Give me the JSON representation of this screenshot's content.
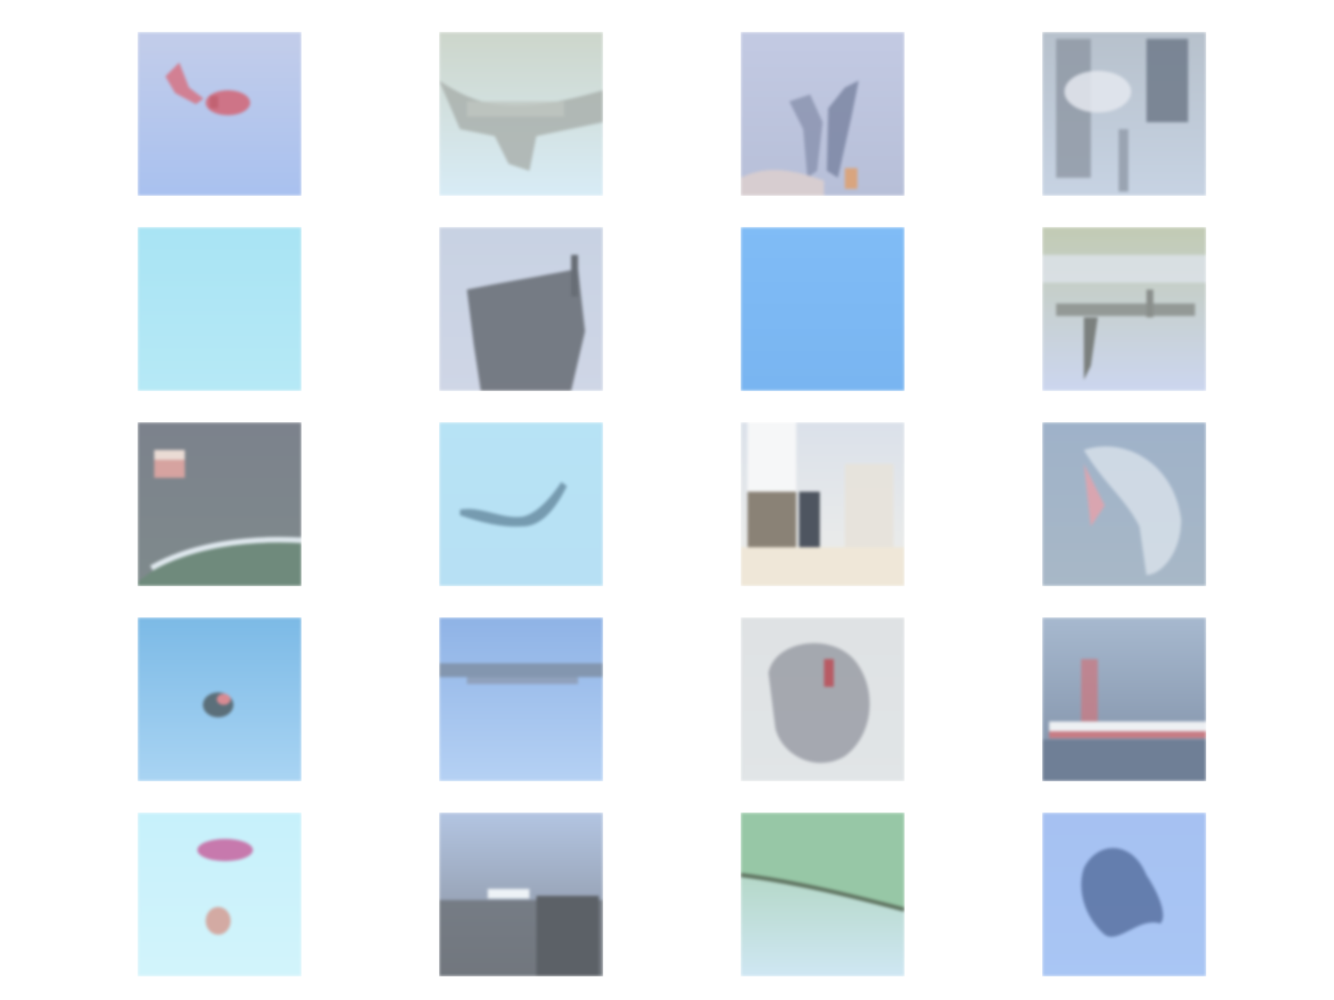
{
  "grid": {
    "rows": 5,
    "cols": 4,
    "tiles": [
      {
        "name": "tile-red-aircraft-sky",
        "bg_top": "#c3cdea",
        "bg_bottom": "#a9c1ef",
        "subject": "#d4788a"
      },
      {
        "name": "tile-gray-object-pale-sky",
        "bg_top": "#cdd6cb",
        "bg_bottom": "#d8ecf6",
        "subject": "#a7aeaa"
      },
      {
        "name": "tile-figures-gray-sky",
        "bg_top": "#c3cae3",
        "bg_bottom": "#b7bfd8",
        "subject": "#8e97b2"
      },
      {
        "name": "tile-dark-structure",
        "bg_top": "#b7c1cc",
        "bg_bottom": "#c7d3e3",
        "subject": "#737e8e"
      },
      {
        "name": "tile-plain-cyan-sky",
        "bg_top": "#a9e4f4",
        "bg_bottom": "#b6e9f6",
        "subject": "#a9e4f4"
      },
      {
        "name": "tile-dark-ship-hull",
        "bg_top": "#c8d2e3",
        "bg_bottom": "#cfd6e6",
        "subject": "#6c7179"
      },
      {
        "name": "tile-plain-blue-sky",
        "bg_top": "#80bcf6",
        "bg_bottom": "#79b5f1",
        "subject": "#80bcf6"
      },
      {
        "name": "tile-jet-over-ground",
        "bg_top": "#c2cbb4",
        "bg_bottom": "#ccd6ef",
        "subject": "#8a8f8c"
      },
      {
        "name": "tile-flag-over-earth",
        "bg_top": "#7c828c",
        "bg_bottom": "#7f8a8c",
        "subject": "#d6a3a0"
      },
      {
        "name": "tile-bird-cyan-sky",
        "bg_top": "#b7e3f5",
        "bg_bottom": "#b7e0f4",
        "subject": "#6f94a8"
      },
      {
        "name": "tile-street-scene",
        "bg_top": "#dbe1ea",
        "bg_bottom": "#eeeeea",
        "subject": "#8a8276"
      },
      {
        "name": "tile-bird-dark-bg",
        "bg_top": "#9fb2c9",
        "bg_bottom": "#a8b8c7",
        "subject": "#dde5ee"
      },
      {
        "name": "tile-small-plane-blue-sky",
        "bg_top": "#7cbae6",
        "bg_bottom": "#a9d4f3",
        "subject": "#5b6f7a"
      },
      {
        "name": "tile-airliner-blue-sky",
        "bg_top": "#8fb3e6",
        "bg_bottom": "#b5d1f4",
        "subject": "#7f8fa5"
      },
      {
        "name": "tile-gray-creature",
        "bg_top": "#dfe2e4",
        "bg_bottom": "#e1e5e7",
        "subject": "#9a9ea6"
      },
      {
        "name": "tile-boat-on-water",
        "bg_top": "#a7b9cf",
        "bg_bottom": "#7e8ea5",
        "subject": "#c77c84"
      },
      {
        "name": "tile-pink-object-pale-sky",
        "bg_top": "#c7f1fb",
        "bg_bottom": "#d2f4fb",
        "subject": "#c66ca4"
      },
      {
        "name": "tile-dark-landscape",
        "bg_top": "#b3c5e2",
        "bg_bottom": "#838a95",
        "subject": "#6d7278"
      },
      {
        "name": "tile-green-field-sky",
        "bg_top": "#a5cfae",
        "bg_bottom": "#cfe7f3",
        "subject": "#97c7a6"
      },
      {
        "name": "tile-dark-bird-blue-sky",
        "bg_top": "#a6c1f2",
        "bg_bottom": "#a9c6f4",
        "subject": "#5d77a6"
      }
    ]
  }
}
